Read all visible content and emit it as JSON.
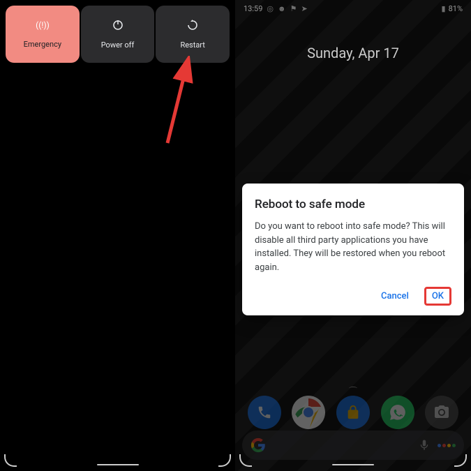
{
  "power_menu": {
    "emergency": "Emergency",
    "poweroff": "Power off",
    "restart": "Restart"
  },
  "status": {
    "time": "13:59",
    "battery": "81%"
  },
  "date": "Sunday, Apr 17",
  "dialog": {
    "title": "Reboot to safe mode",
    "body": "Do you want to reboot into safe mode? This will disable all third party applications you have installed. They will be restored when you reboot again.",
    "cancel": "Cancel",
    "ok": "OK"
  }
}
